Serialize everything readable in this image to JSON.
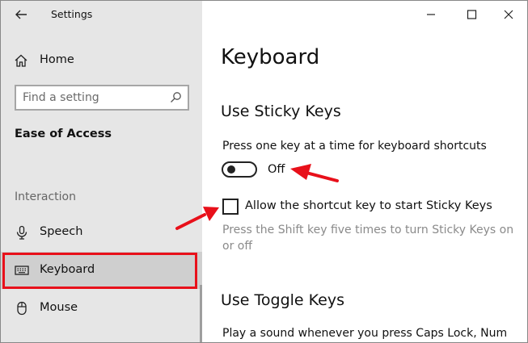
{
  "window": {
    "title": "Settings"
  },
  "sidebar": {
    "home_label": "Home",
    "search_placeholder": "Find a setting",
    "section_title": "Ease of Access",
    "group_label": "Interaction",
    "items": [
      {
        "label": "Speech",
        "icon": "microphone-icon"
      },
      {
        "label": "Keyboard",
        "icon": "keyboard-icon",
        "selected": true
      },
      {
        "label": "Mouse",
        "icon": "mouse-icon"
      }
    ]
  },
  "main": {
    "page_title": "Keyboard",
    "sticky_keys": {
      "heading": "Use Sticky Keys",
      "description": "Press one key at a time for keyboard shortcuts",
      "toggle_state": "Off",
      "checkbox_label": "Allow the shortcut key to start Sticky Keys",
      "checkbox_checked": false,
      "hint": "Press the Shift key five times to turn Sticky Keys on or off"
    },
    "toggle_keys": {
      "heading": "Use Toggle Keys",
      "description": "Play a sound whenever you press Caps Lock, Num"
    }
  },
  "colors": {
    "annotation_red": "#e8101a",
    "sidebar_bg": "#e6e6e6",
    "selected_bg": "#cfcfcf"
  }
}
